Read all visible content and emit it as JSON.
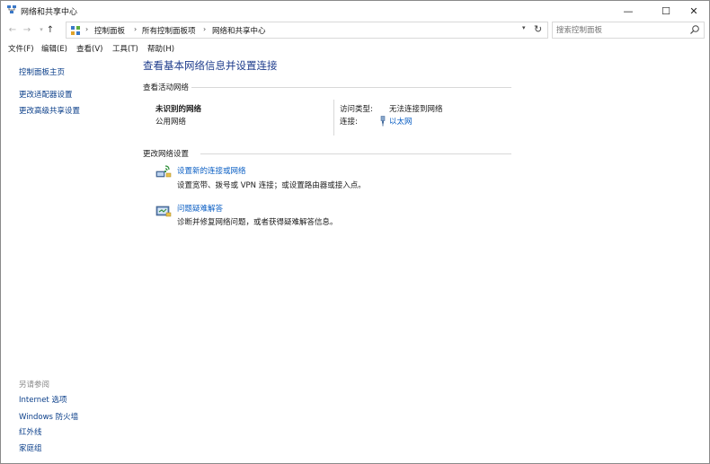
{
  "window": {
    "title": "网络和共享中心",
    "minimize_glyph": "—",
    "maximize_glyph": "☐",
    "close_glyph": "✕"
  },
  "nav": {
    "back_glyph": "←",
    "forward_glyph": "→",
    "recent_glyph": "▾",
    "up_glyph": "↑"
  },
  "address": {
    "crumbs": [
      "控制面板",
      "所有控制面板项",
      "网络和共享中心"
    ],
    "separator": "›",
    "dropdown_glyph": "▾",
    "refresh_glyph": "↻"
  },
  "search": {
    "placeholder": "搜索控制面板"
  },
  "menu": {
    "items": [
      "文件(F)",
      "编辑(E)",
      "查看(V)",
      "工具(T)",
      "帮助(H)"
    ]
  },
  "sidebar": {
    "links": [
      "控制面板主页",
      "更改适配器设置",
      "更改高级共享设置"
    ],
    "see_also_heading": "另请参阅",
    "see_also": [
      "Internet 选项",
      "Windows 防火墙",
      "红外线",
      "家庭组"
    ]
  },
  "main": {
    "title": "查看基本网络信息并设置连接",
    "active_heading": "查看活动网络",
    "network": {
      "name": "未识别的网络",
      "type": "公用网络",
      "access_label": "访问类型:",
      "access_value": "无法连接到网络",
      "connection_label": "连接:",
      "connection_value": "以太网"
    },
    "change_heading": "更改网络设置",
    "tasks": [
      {
        "link": "设置新的连接或网络",
        "desc": "设置宽带、拨号或 VPN 连接；或设置路由器或接入点。"
      },
      {
        "link": "问题疑难解答",
        "desc": "诊断并修复网络问题，或者获得疑难解答信息。"
      }
    ]
  },
  "colors": {
    "link": "#0b5fc4",
    "title": "#1e3c8c",
    "sidebar_link": "#0b3f8a",
    "muted": "#8a8a8a"
  },
  "icons": {
    "app": "network-center-icon",
    "address": "control-panel-icon",
    "search": "search-icon",
    "ethernet": "ethernet-icon",
    "new_connection": "new-connection-icon",
    "troubleshoot": "troubleshoot-icon"
  }
}
